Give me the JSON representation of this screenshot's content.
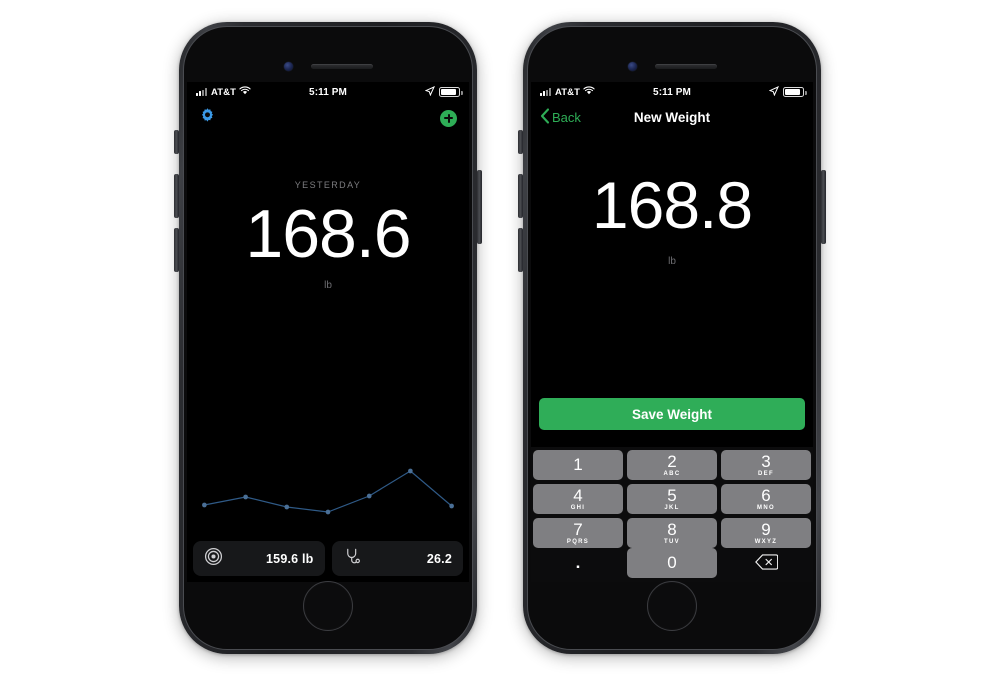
{
  "scene": {
    "background": "#ffffff",
    "device_count": 2,
    "accent_green": "#2fad58",
    "accent_blue": "#3b9ae8",
    "chart_line_color": "#2f5a87"
  },
  "status_bar": {
    "carrier": "AT&T",
    "signal_icon": "signal-bars-icon",
    "wifi_icon": "wifi-icon",
    "time": "5:11 PM",
    "location_icon": "location-arrow-icon",
    "battery_icon": "battery-icon",
    "battery_level_pct": 88
  },
  "screen_home": {
    "settings_icon": "gear-icon",
    "add_icon": "plus-circle-icon",
    "hero": {
      "label": "YESTERDAY",
      "value": "168.6",
      "unit": "lb"
    },
    "stats": [
      {
        "icon": "target-icon",
        "name": "goal-weight",
        "value": "159.6 lb"
      },
      {
        "icon": "stethoscope-icon",
        "name": "bmi",
        "value": "26.2"
      }
    ]
  },
  "screen_new_weight": {
    "back_label": "Back",
    "back_icon": "chevron-left-icon",
    "title": "New Weight",
    "hero": {
      "value": "168.8",
      "unit": "lb"
    },
    "save_label": "Save Weight",
    "keypad": [
      [
        {
          "num": "1",
          "sub": ""
        },
        {
          "num": "2",
          "sub": "ABC"
        },
        {
          "num": "3",
          "sub": "DEF"
        }
      ],
      [
        {
          "num": "4",
          "sub": "GHI"
        },
        {
          "num": "5",
          "sub": "JKL"
        },
        {
          "num": "6",
          "sub": "MNO"
        }
      ],
      [
        {
          "num": "7",
          "sub": "PQRS"
        },
        {
          "num": "8",
          "sub": "TUV"
        },
        {
          "num": "9",
          "sub": "WXYZ"
        }
      ]
    ],
    "keypad_bottom": {
      "decimal": ".",
      "zero": "0",
      "delete_icon": "backspace-icon"
    }
  },
  "chart_data": {
    "type": "line",
    "title": "",
    "xlabel": "",
    "ylabel": "",
    "grid": false,
    "legend": "none",
    "x": [
      1,
      2,
      3,
      4,
      5,
      6,
      7
    ],
    "values": [
      168.6,
      169.4,
      168.4,
      167.9,
      169.5,
      172.0,
      168.5
    ],
    "ylim": [
      167.0,
      173.0
    ],
    "marker": "circle",
    "line_color": "#2f5a87",
    "marker_color": "#4a6f96"
  }
}
